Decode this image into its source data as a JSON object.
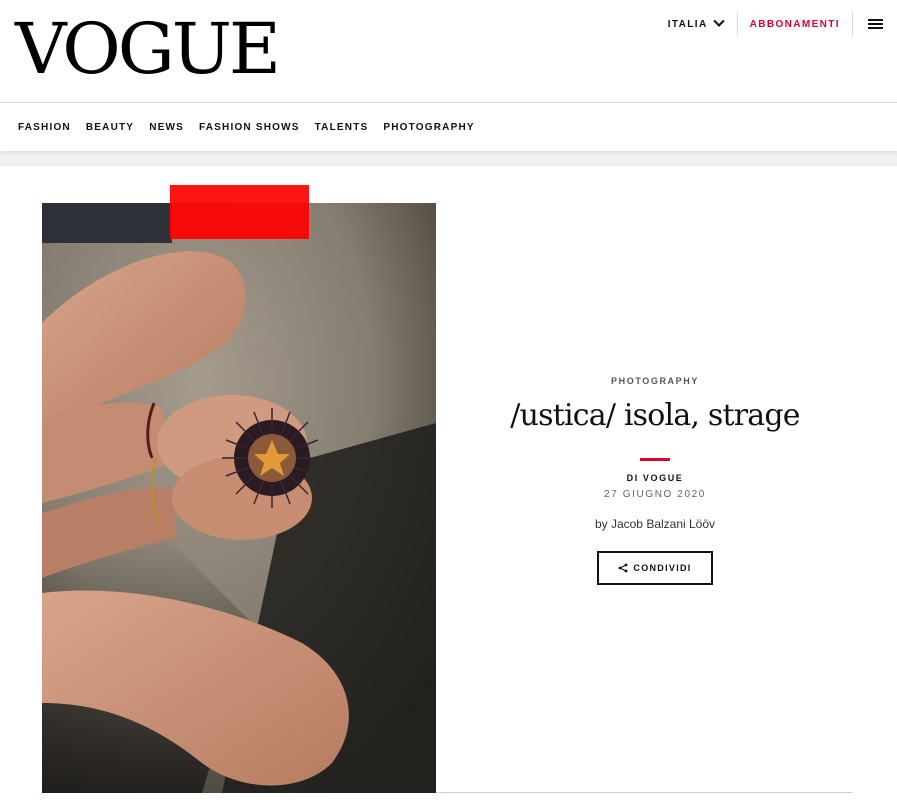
{
  "header": {
    "logo": "VOGUE",
    "edition": "ITALIA",
    "subscribe": "ABBONAMENTI"
  },
  "nav": [
    "FASHION",
    "BEAUTY",
    "NEWS",
    "FASHION SHOWS",
    "TALENTS",
    "PHOTOGRAPHY"
  ],
  "article": {
    "kicker": "PHOTOGRAPHY",
    "title": "/ustica/ isola, strage",
    "byline": "DI VOGUE",
    "date": "27 GIUGNO 2020",
    "author": "by Jacob Balzani Lööv",
    "share_label": "CONDIVIDI"
  },
  "colors": {
    "accent": "#e0002a",
    "red_block": "#ff0000",
    "text": "#111111"
  },
  "icons": {
    "edition_toggle": "chevron-down-icon",
    "menu": "hamburger-menu-icon",
    "share": "share-icon"
  }
}
